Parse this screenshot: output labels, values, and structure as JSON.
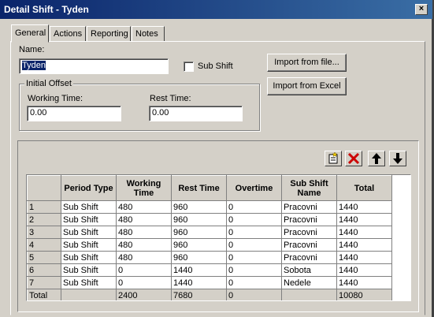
{
  "window": {
    "title": "Detail Shift - Tyden",
    "close_glyph": "×"
  },
  "tabs": [
    {
      "label": "General",
      "active": true
    },
    {
      "label": "Actions"
    },
    {
      "label": "Reporting"
    },
    {
      "label": "Notes"
    }
  ],
  "form": {
    "name_label": "Name:",
    "name_value": "Tyden",
    "sub_shift_label": "Sub Shift",
    "sub_shift_checked": false,
    "initial_offset_label": "Initial Offset",
    "working_time_label": "Working Time:",
    "working_time_value": "0.00",
    "rest_time_label": "Rest Time:",
    "rest_time_value": "0.00",
    "import_file_label": "Import from file...",
    "import_excel_label": "Import from Excel"
  },
  "toolbar": {
    "icons": [
      "new-row-icon",
      "delete-icon",
      "move-up-icon",
      "move-down-icon"
    ]
  },
  "grid": {
    "columns": [
      "Period Type",
      "Working Time",
      "Rest Time",
      "Overtime",
      "Sub Shift Name",
      "Total"
    ],
    "rows": [
      {
        "num": "1",
        "period_type": "Sub Shift",
        "working": "480",
        "rest": "960",
        "overtime": "0",
        "sub_shift_name": "Pracovni",
        "total": "1440"
      },
      {
        "num": "2",
        "period_type": "Sub Shift",
        "working": "480",
        "rest": "960",
        "overtime": "0",
        "sub_shift_name": "Pracovni",
        "total": "1440"
      },
      {
        "num": "3",
        "period_type": "Sub Shift",
        "working": "480",
        "rest": "960",
        "overtime": "0",
        "sub_shift_name": "Pracovni",
        "total": "1440"
      },
      {
        "num": "4",
        "period_type": "Sub Shift",
        "working": "480",
        "rest": "960",
        "overtime": "0",
        "sub_shift_name": "Pracovni",
        "total": "1440"
      },
      {
        "num": "5",
        "period_type": "Sub Shift",
        "working": "480",
        "rest": "960",
        "overtime": "0",
        "sub_shift_name": "Pracovni",
        "total": "1440"
      },
      {
        "num": "6",
        "period_type": "Sub Shift",
        "working": "0",
        "rest": "1440",
        "overtime": "0",
        "sub_shift_name": "Sobota",
        "total": "1440"
      },
      {
        "num": "7",
        "period_type": "Sub Shift",
        "working": "0",
        "rest": "1440",
        "overtime": "0",
        "sub_shift_name": "Nedele",
        "total": "1440"
      }
    ],
    "total_row": {
      "label": "Total",
      "period_type": "",
      "working": "2400",
      "rest": "7680",
      "overtime": "0",
      "sub_shift_name": "",
      "total": "10080"
    }
  },
  "colors": {
    "titlebar_start": "#0a246a",
    "titlebar_end": "#3a6ea5",
    "face": "#d4d0c8",
    "delete_red": "#cc0000"
  }
}
